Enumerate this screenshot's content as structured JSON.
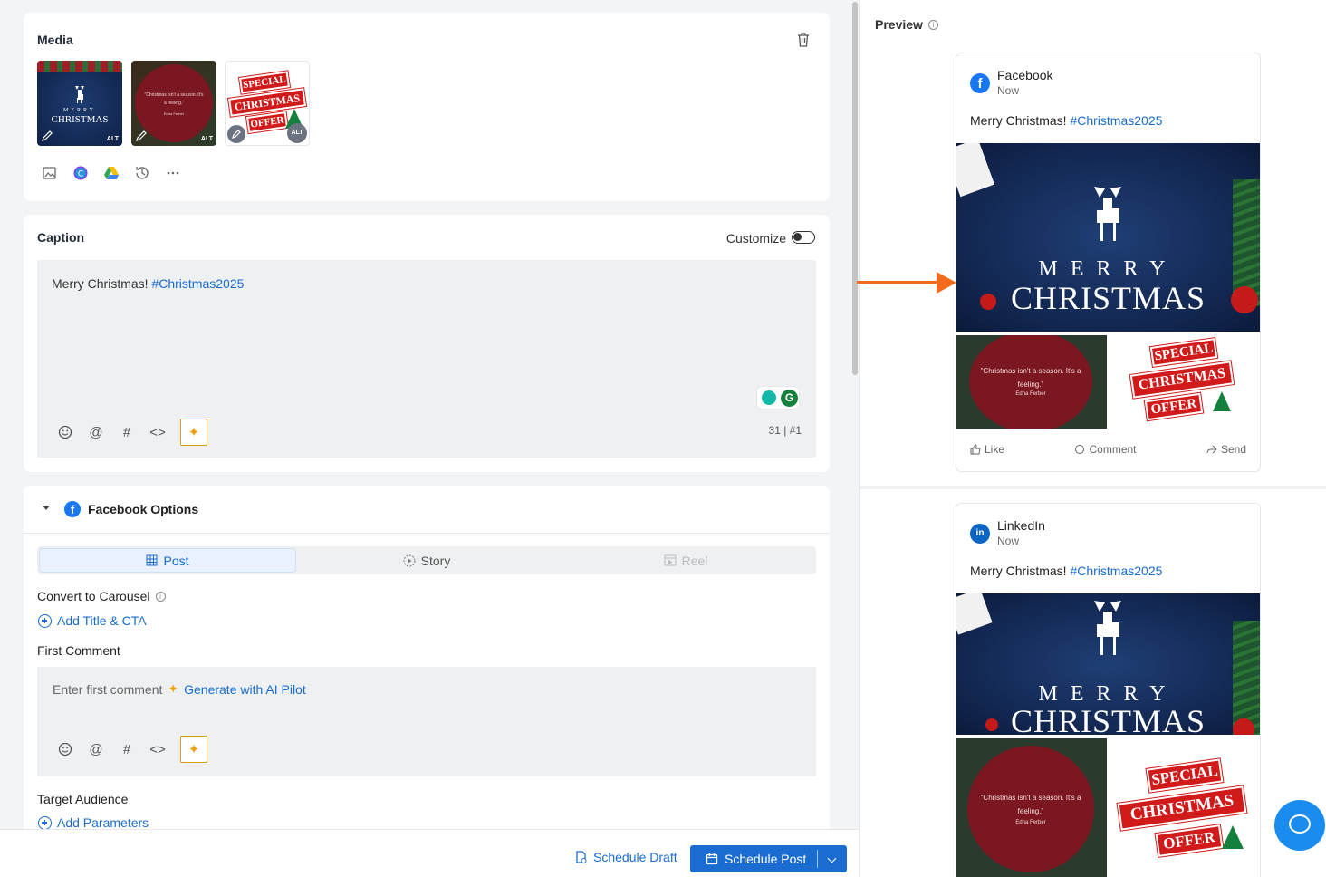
{
  "media": {
    "title": "Media",
    "thumbs": [
      {
        "line1": "MERRY",
        "line2": "CHRISTMAS",
        "alt": "ALT"
      },
      {
        "quote": "\"Christmas isn't a season. It's a feeling.\"",
        "attrib": "Edna Ferber",
        "alt": "ALT"
      },
      {
        "l1": "SPECIAL",
        "l2": "CHRISTMAS",
        "l3": "OFFER",
        "alt": "ALT"
      }
    ]
  },
  "caption": {
    "title": "Caption",
    "customize_label": "Customize",
    "text_plain": "Merry Christmas! ",
    "text_hashtag": "#Christmas2025",
    "counter": "31 | #1"
  },
  "facebook_options": {
    "title": "Facebook Options",
    "tabs": [
      {
        "label": "Post"
      },
      {
        "label": "Story"
      },
      {
        "label": "Reel"
      }
    ],
    "convert_label": "Convert to Carousel",
    "add_title_cta": "Add Title & CTA",
    "first_comment_label": "First Comment",
    "first_comment_placeholder": "Enter first comment",
    "generate_ai": "Generate with AI Pilot",
    "target_audience_label": "Target Audience",
    "add_parameters": "Add Parameters"
  },
  "footer": {
    "schedule_draft": "Schedule Draft",
    "schedule_post": "Schedule Post"
  },
  "preview": {
    "title": "Preview",
    "cards": [
      {
        "network": "Facebook",
        "time": "Now",
        "text_plain": "Merry Christmas! ",
        "text_hashtag": "#Christmas2025",
        "merry": "MERRY",
        "christmas": "CHRISTMAS",
        "quote": "\"Christmas isn't a season. It's a feeling.\"",
        "attrib": "Edna Ferber",
        "offer_l1": "SPECIAL",
        "offer_l2": "CHRISTMAS",
        "offer_l3": "OFFER",
        "actions": {
          "like": "Like",
          "comment": "Comment",
          "send": "Send"
        }
      },
      {
        "network": "LinkedIn",
        "time": "Now",
        "text_plain": "Merry Christmas! ",
        "text_hashtag": "#Christmas2025",
        "merry": "MERRY",
        "christmas": "CHRISTMAS",
        "quote": "\"Christmas isn't a season. It's a feeling.\"",
        "attrib": "Edna Ferber",
        "offer_l1": "SPECIAL",
        "offer_l2": "CHRISTMAS",
        "offer_l3": "OFFER"
      }
    ]
  },
  "colors": {
    "accent": "#1a6cd1",
    "facebook": "#1877f2",
    "linkedin": "#0a66c2",
    "arrow": "#f26a1b",
    "ai_star": "#f59e0b"
  }
}
